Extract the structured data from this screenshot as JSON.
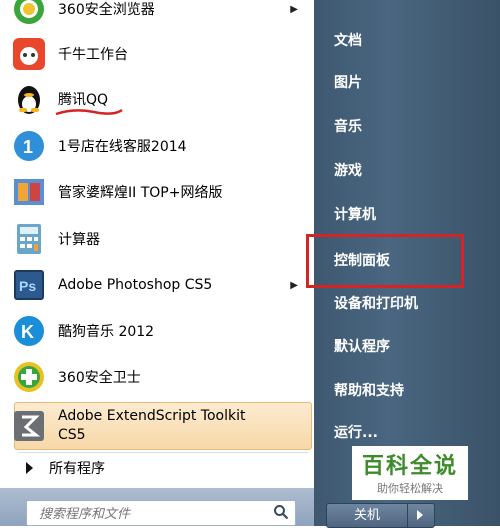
{
  "programs": [
    {
      "label": "360安全浏览器",
      "icon": "360-browser-icon",
      "has_arrow": true
    },
    {
      "label": "千牛工作台",
      "icon": "qianniu-icon",
      "has_arrow": false
    },
    {
      "label": "腾讯QQ",
      "icon": "qq-penguin-icon",
      "has_arrow": false
    },
    {
      "label": "1号店在线客服2014",
      "icon": "yhd-chat-icon",
      "has_arrow": false
    },
    {
      "label": "管家婆辉煌II TOP+网络版",
      "icon": "guanjiapo-icon",
      "has_arrow": false
    },
    {
      "label": "计算器",
      "icon": "calculator-icon",
      "has_arrow": false
    },
    {
      "label": "Adobe Photoshop CS5",
      "icon": "photoshop-icon",
      "has_arrow": true
    },
    {
      "label": "酷狗音乐 2012",
      "icon": "kugou-icon",
      "has_arrow": false
    },
    {
      "label": "360安全卫士",
      "icon": "360-guard-icon",
      "has_arrow": false
    }
  ],
  "highlighted_program": {
    "line1": "Adobe ExtendScript Toolkit",
    "line2": "CS5",
    "icon": "extendscript-icon"
  },
  "all_programs_label": "所有程序",
  "search": {
    "placeholder": "搜索程序和文件"
  },
  "right_menu": {
    "documents": "文档",
    "pictures": "图片",
    "music": "音乐",
    "games": "游戏",
    "computer": "计算机",
    "control_panel": "控制面板",
    "devices_printers": "设备和打印机",
    "default_programs": "默认程序",
    "help_support": "帮助和支持",
    "run": "运行..."
  },
  "shutdown_label": "关机",
  "watermark": {
    "title": "百科全说",
    "subtitle": "助你轻松解决"
  },
  "colors": {
    "highlight_box": "#d42424",
    "right_panel": "#4a6680",
    "watermark_green": "#3d8c2a"
  }
}
